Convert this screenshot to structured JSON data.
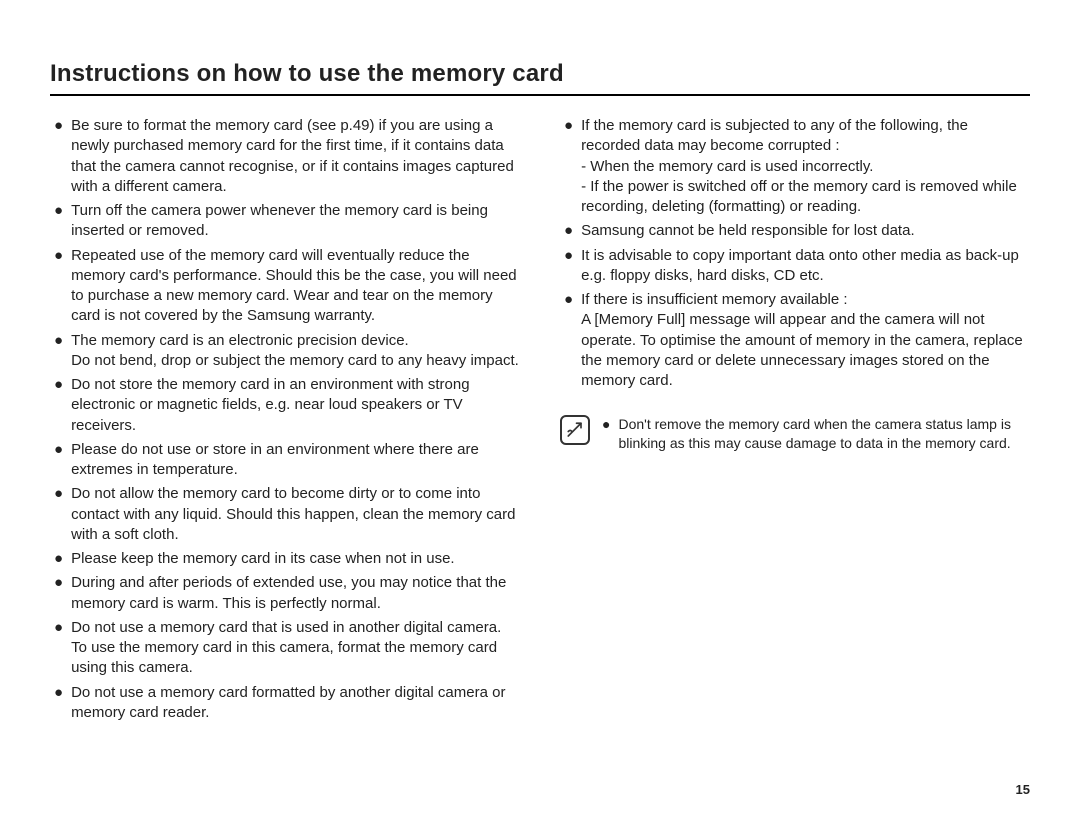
{
  "title": "Instructions on how to use the memory card",
  "pageNumber": "15",
  "leftBullets": [
    "Be sure to format the memory card (see p.49) if you are using a newly purchased memory card for the first time, if it contains data that the camera cannot recognise, or if it contains images captured with a different camera.",
    "Turn off the camera power whenever the memory card is being inserted or removed.",
    "Repeated use of the memory card will eventually reduce the memory card's performance. Should this be the case, you will need to purchase a new memory card. Wear and tear on the memory card is not covered by the Samsung warranty.",
    "The memory card is an electronic precision device.\nDo not bend, drop or subject the memory card to any heavy impact.",
    "Do not store the memory card in an environment with strong electronic or magnetic fields, e.g. near loud speakers or TV receivers.",
    "Please do not use or store in an environment where there are extremes in temperature.",
    "Do not allow the memory card to become dirty or to come into contact with any liquid. Should this happen, clean the memory card with a soft cloth.",
    "Please keep the memory card in its case when not in use.",
    "During and after periods of extended use, you may notice that the memory card is warm. This is perfectly normal.",
    "Do not use a memory card that is used in another digital camera. To use the memory card in this camera, format the memory card using this camera.",
    "Do not use a memory card formatted by another digital camera or memory card reader."
  ],
  "rightBullets": [
    {
      "text": "If the memory card is subjected to any of the following, the recorded data may become corrupted :",
      "subs": [
        "- When the memory card is used incorrectly.",
        "- If the power is switched off or the memory card is removed while recording, deleting (formatting) or reading."
      ]
    },
    {
      "text": "Samsung cannot be held responsible for lost data."
    },
    {
      "text": "It is advisable to copy important data onto other media as back-up e.g. floppy disks, hard disks, CD etc."
    },
    {
      "text": "If there is insufficient memory available :\nA [Memory Full] message will appear and the camera will not operate. To optimise the amount of memory in the camera, replace the memory card or delete unnecessary images stored on the memory card."
    }
  ],
  "noteBullet": "Don't remove the memory card when the camera status lamp is blinking as this may cause damage to data in the memory card."
}
